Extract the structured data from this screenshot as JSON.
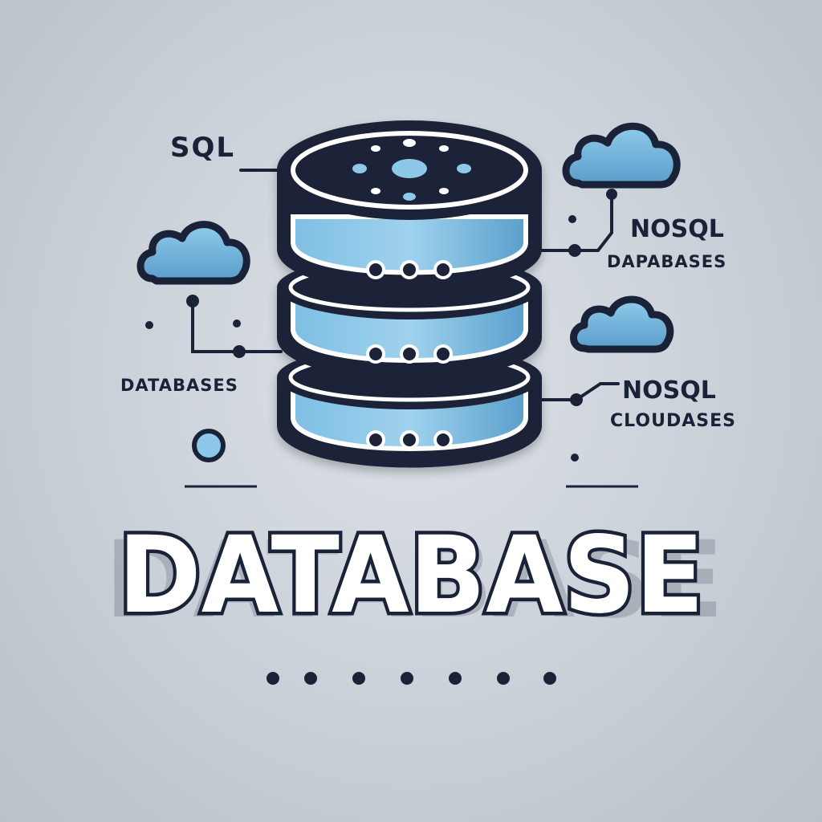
{
  "title": "DATABASE",
  "labels": {
    "sql": "SQL",
    "nosql_top": "NOSQL",
    "dapabases": "DAPABASES",
    "databases_left": "DATABASES",
    "nosql_bottom": "NOSQL",
    "cloudases": "CLOUDASES"
  },
  "colors": {
    "background": "#c9d0d7",
    "outline": "#1a2238",
    "accent_blue": "#5fa8d6",
    "light_blue": "#8ec8e8",
    "white": "#ffffff"
  },
  "icons": [
    "database-cylinder-icon",
    "cloud-icon",
    "connector-line",
    "dot-row"
  ]
}
